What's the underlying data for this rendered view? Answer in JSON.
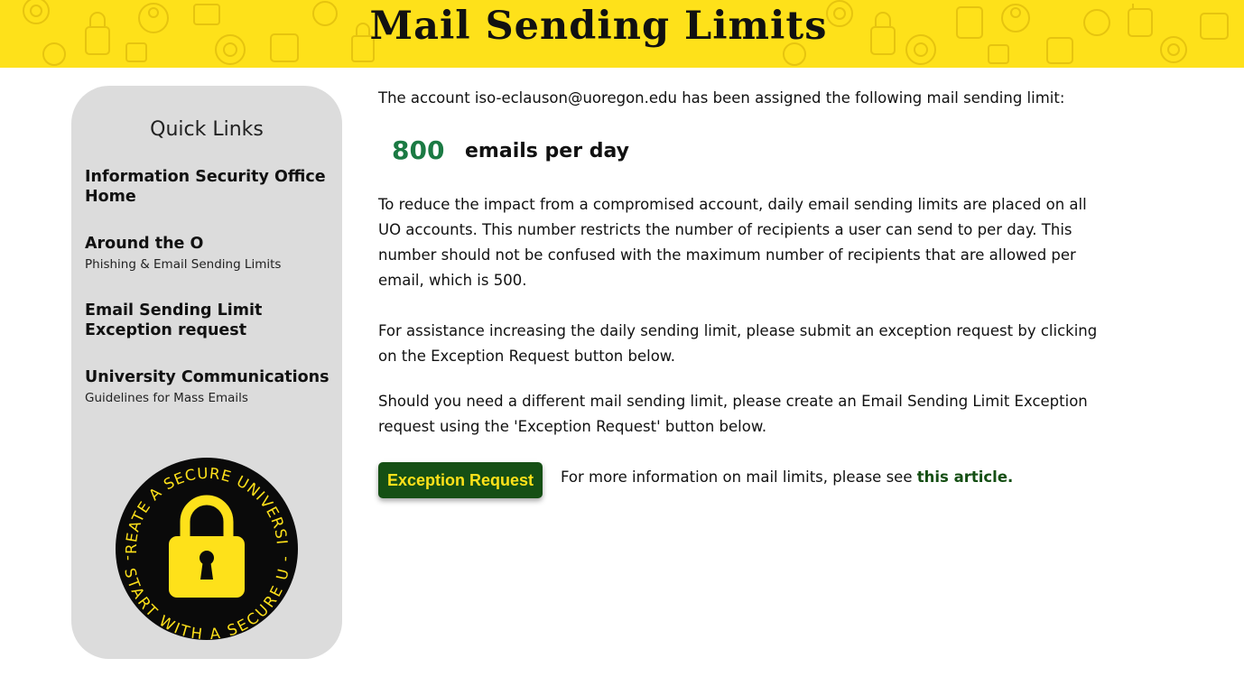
{
  "header": {
    "title": "Mail Sending Limits"
  },
  "sidebar": {
    "title": "Quick Links",
    "links": [
      {
        "label": "Information Security Office Home",
        "sub": ""
      },
      {
        "label": "Around the O",
        "sub": "Phishing & Email Sending Limits"
      },
      {
        "label": "Email Sending Limit Exception request",
        "sub": ""
      },
      {
        "label": "University Communications",
        "sub": "Guidelines for Mass Emails"
      }
    ],
    "seal": {
      "top_text": "CREATE A SECURE UNIVERSITY",
      "bottom_text": "- START WITH A SECURE U -",
      "icon": "lock-icon"
    }
  },
  "main": {
    "intro": "The account iso-eclauson@uoregon.edu has been assigned the following mail sending limit:",
    "limit_value": "800",
    "limit_unit": "emails per day",
    "para1": "To reduce the impact from a compromised account, daily email sending limits are placed on all UO accounts. This number restricts the number of recipients a user can send to per day. This number should not be confused with the maximum number of recipients that are allowed per email, which is 500.",
    "para2": "For assistance increasing the daily sending limit, please submit an exception request by clicking on the Exception Request button below.",
    "para3": "Should you need a different mail sending limit, please create an Email Sending Limit Exception request using the 'Exception Request' button below.",
    "button_label": "Exception Request",
    "more_info_text": "For more information on mail limits, please see ",
    "more_info_link": "this article."
  },
  "colors": {
    "banner": "#fee11a",
    "sidebar_bg": "#dcdcdc",
    "accent_green": "#154f14",
    "limit_green": "#1b7a43"
  }
}
